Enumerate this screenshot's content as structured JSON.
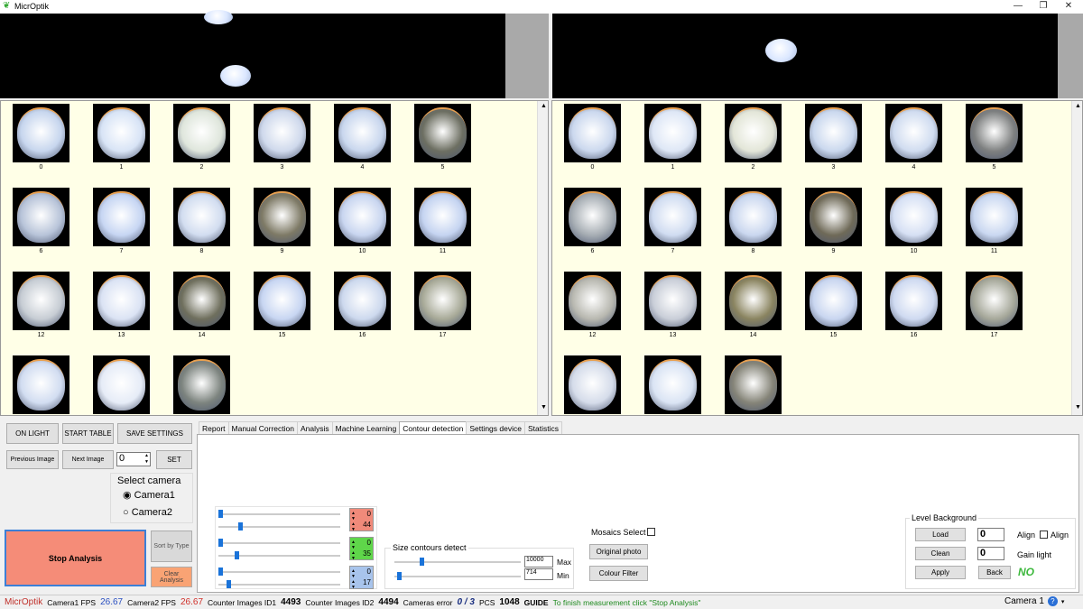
{
  "window": {
    "title": "MicrOptik",
    "min": "—",
    "restore": "❐",
    "close": "✕"
  },
  "gallery_left": {
    "items": [
      "0",
      "1",
      "2",
      "3",
      "4",
      "5",
      "6",
      "7",
      "8",
      "9",
      "10",
      "11",
      "12",
      "13",
      "14",
      "15",
      "16",
      "17",
      "",
      "",
      ""
    ],
    "colors": [
      "#c7d6ee",
      "#d8e4f6",
      "#dfe6dc",
      "#cfd9ec",
      "#c9d7ee",
      "#6d6f62",
      "#b8c4d9",
      "#c7d6f3",
      "#d2ddf0",
      "#7e7a66",
      "#c9d6f0",
      "#c5d4f1",
      "#c7cdd4",
      "#dbe3f4",
      "#6f6f5d",
      "#c8d6f2",
      "#cdd9ee",
      "#a8aa98",
      "#d2ddf1",
      "#e6ecf7",
      "#7d847f"
    ]
  },
  "gallery_right": {
    "items": [
      "0",
      "1",
      "2",
      "3",
      "4",
      "5",
      "6",
      "7",
      "8",
      "9",
      "10",
      "11",
      "12",
      "13",
      "14",
      "15",
      "16",
      "17",
      "",
      "",
      ""
    ],
    "colors": [
      "#cbd8ee",
      "#dee7f6",
      "#e3e6d8",
      "#cad8ee",
      "#d0dcf0",
      "#7e8080",
      "#a7aeb4",
      "#d0dcf1",
      "#cad7ef",
      "#6f6a58",
      "#d6e0f4",
      "#cad8f1",
      "#b8b8b0",
      "#c9ced8",
      "#8a8460",
      "#c9d6f0",
      "#cfdaf1",
      "#a6a89a",
      "#d5dcea",
      "#dae4f4",
      "#858478"
    ]
  },
  "controls": {
    "on_light": "ON LIGHT",
    "start_table": "START TABLE",
    "save_settings": "SAVE SETTINGS",
    "previous_image": "Previous Image",
    "next_image": "Next Image",
    "image_index": "0",
    "set": "SET",
    "select_camera": "Select camera",
    "camera1": "Camera1",
    "camera2": "Camera2",
    "stop_analysis": "Stop Analysis",
    "sort_by_type": "Sort by Type",
    "clear_analysis": "Clear Analysis"
  },
  "tabs": [
    "Report",
    "Manual Correction",
    "Analysis",
    "Machine Learning",
    "Contour detection",
    "Settings device",
    "Statistics"
  ],
  "contour": {
    "rgb": [
      {
        "a": "0",
        "b": "44",
        "color": "#f08a7a",
        "a_level": 0.0,
        "b_level": 0.17
      },
      {
        "a": "0",
        "b": "35",
        "color": "#5fd64a",
        "a_level": 0.0,
        "b_level": 0.14
      },
      {
        "a": "0",
        "b": "17",
        "color": "#a8c4ec",
        "a_level": 0.0,
        "b_level": 0.07
      }
    ],
    "size_title": "Size contours detect",
    "max_value": "10000",
    "max_label": "Max",
    "min_value": "714",
    "min_label": "Min",
    "mosaics_select": "Mosaics Select",
    "original_photo": "Original photo",
    "colour_filter": "Colour Filter"
  },
  "level_background": {
    "title": "Level Background",
    "load": "Load",
    "clean": "Clean",
    "apply": "Apply",
    "back": "Back",
    "align_value": "0",
    "align_label": "Align",
    "align_check": "Align",
    "gain_value": "0",
    "gain_label": "Gain light",
    "status": "NO"
  },
  "statusbar": {
    "brand": "MicrOptik",
    "cam1_label": "Camera1 FPS",
    "cam1_fps": "26.67",
    "cam2_label": "Camera2 FPS",
    "cam2_fps": "26.67",
    "counter1_label": "Counter Images ID1",
    "counter1": "4493",
    "counter2_label": "Counter Images ID2",
    "counter2": "4494",
    "cameras_error_label": "Cameras error",
    "cameras_error": "0 / 3",
    "pcs_label": "PCS",
    "pcs": "1048",
    "guide_label": "GUIDE",
    "guide": "To finish measurement click \"Stop Analysis\"",
    "camera_select": "Camera 1"
  }
}
